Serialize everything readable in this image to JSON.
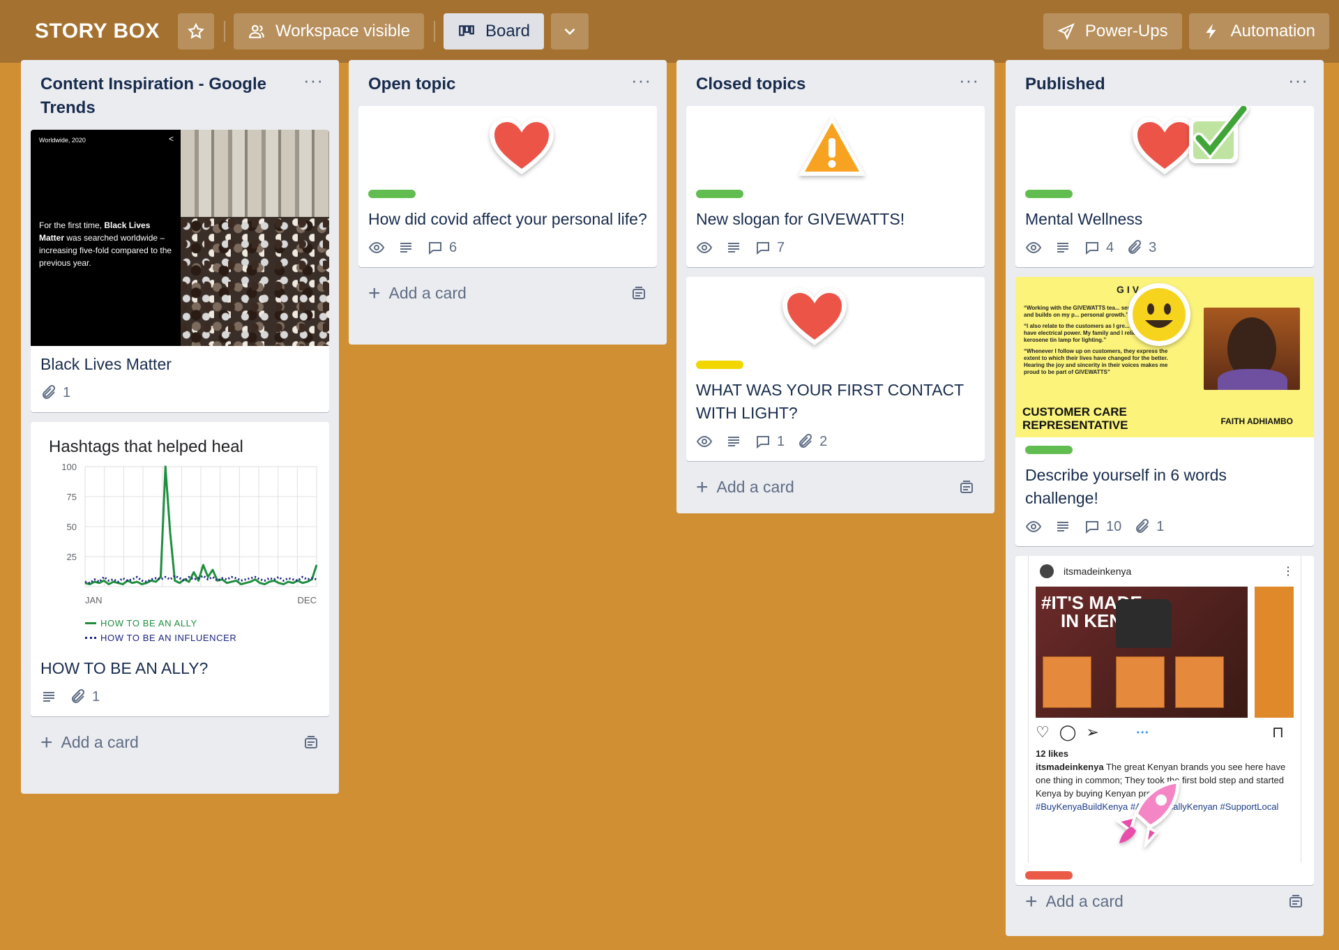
{
  "header": {
    "board_title": "STORY BOX",
    "workspace_label": "Workspace visible",
    "board_label": "Board",
    "powerups_label": "Power-Ups",
    "automation_label": "Automation"
  },
  "colors": {
    "background": "#d08f32",
    "header": "#a57130",
    "label_green": "#61bd4f",
    "label_yellow": "#f2d600",
    "label_red": "#eb5a46"
  },
  "add_card_label": "Add a card",
  "lists": [
    {
      "title": "Content Inspiration - Google Trends",
      "cards": [
        {
          "cover": {
            "corner": "Worldwide, 2020",
            "text_pre": "For the first time, ",
            "text_bold": "Black Lives Matter",
            "text_post": " was searched worldwide – increasing five-fold compared to the previous year."
          },
          "title": "Black Lives Matter",
          "attachments": "1"
        },
        {
          "cover_chart": {
            "title": "Hashtags that helped heal"
          },
          "title": "HOW TO BE AN ALLY?",
          "attachments": "1"
        }
      ]
    },
    {
      "title": "Open topic",
      "cards": [
        {
          "title": "How did covid affect your personal life?",
          "comments": "6",
          "sticker": "heart"
        }
      ]
    },
    {
      "title": "Closed topics",
      "cards": [
        {
          "title": "New slogan for GIVEWATTS!",
          "comments": "7",
          "sticker": "warning"
        },
        {
          "title": "WHAT WAS YOUR FIRST CONTACT WITH LIGHT?",
          "comments": "1",
          "attachments": "2",
          "sticker": "heart"
        }
      ]
    },
    {
      "title": "Published",
      "cards": [
        {
          "title": "Mental Wellness",
          "comments": "4",
          "attachments": "3",
          "sticker": "heart-check"
        },
        {
          "cover": {
            "brand": "GIV    TTS",
            "quote1": "“Working with the GIVEWATTS tea... sense of pride and builds on my p... personal growth.”",
            "quote2": "“I also relate to the customers as I gre... that does not have electrical power. My family and I relied on a kerosene tin lamp for lighting.”",
            "quote3": "“Whenever I follow up on customers, they express the extent to which their lives have changed for the better. Hearing the joy and sincerity in their voices makes me proud to be part of GIVEWATTS”",
            "role": "CUSTOMER CARE REPRESENTATIVE",
            "name": "FAITH ADHIAMBO"
          },
          "title": "Describe yourself in 6 words challenge!",
          "comments": "10",
          "attachments": "1"
        },
        {
          "cover_ig": {
            "user": "itsmadeinkenya",
            "hashtag_line1": "#IT'S MADE",
            "hashtag_line2": "IN KENYA",
            "likes": "12 likes",
            "caption_user": "itsmadeinkenya",
            "caption": " The great Kenyan brands you see here have one thing in common; They took the first bold step and started Kenya by buying Kenyan products",
            "tags": "#BuyKenyaBuildKenya #AuthenticallyKenyan #SupportLocal"
          }
        }
      ]
    }
  ],
  "chart_data": {
    "type": "line",
    "title": "Hashtags that helped heal",
    "x_range_labels": [
      "JAN",
      "DEC"
    ],
    "ylim": [
      0,
      100
    ],
    "yticks": [
      25,
      50,
      75,
      100
    ],
    "grid": true,
    "legend_position": "bottom",
    "series": [
      {
        "name": "HOW TO BE AN ALLY",
        "color": "#1e8e3e",
        "values": [
          3,
          2,
          4,
          3,
          5,
          2,
          4,
          3,
          2,
          5,
          3,
          4,
          2,
          3,
          5,
          4,
          8,
          100,
          45,
          5,
          3,
          6,
          4,
          12,
          5,
          18,
          8,
          14,
          5,
          6,
          3,
          4,
          5,
          2,
          3,
          4,
          6,
          3,
          2,
          4,
          5,
          3,
          2,
          4,
          3,
          5,
          3,
          4,
          6,
          18
        ]
      },
      {
        "name": "HOW TO BE AN INFLUENCER",
        "color": "#1a237e",
        "values": [
          4,
          3,
          6,
          4,
          8,
          5,
          6,
          4,
          7,
          5,
          6,
          8,
          5,
          4,
          6,
          7,
          6,
          8,
          6,
          9,
          7,
          5,
          8,
          6,
          7,
          9,
          6,
          8,
          5,
          7,
          6,
          8,
          7,
          5,
          6,
          7,
          8,
          6,
          5,
          7,
          6,
          8,
          5,
          7,
          6,
          5,
          8,
          6,
          7,
          6
        ]
      }
    ]
  }
}
